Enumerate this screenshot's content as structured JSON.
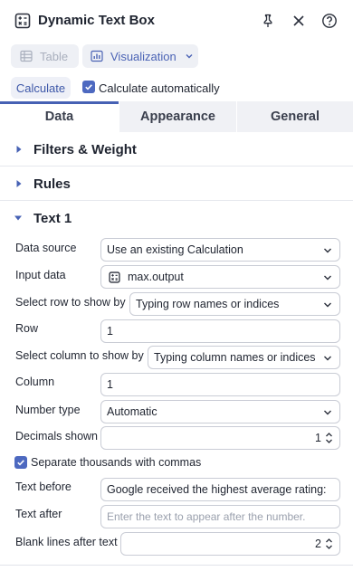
{
  "header": {
    "title": "Dynamic Text Box",
    "icons": [
      "calculator-icon",
      "pin-icon",
      "close-icon",
      "help-icon"
    ]
  },
  "toolbar": {
    "table_label": "Table",
    "visualization_label": "Visualization"
  },
  "calc": {
    "button_label": "Calculate",
    "auto_label": "Calculate automatically",
    "auto_checked": true
  },
  "tabs": [
    {
      "label": "Data",
      "active": true
    },
    {
      "label": "Appearance",
      "active": false
    },
    {
      "label": "General",
      "active": false
    }
  ],
  "sections": {
    "filters": "Filters & Weight",
    "rules": "Rules",
    "text1": "Text 1"
  },
  "form": {
    "data_source": {
      "label": "Data source",
      "value": "Use an existing Calculation"
    },
    "input_data": {
      "label": "Input data",
      "value": "max.output"
    },
    "select_row": {
      "label": "Select row to show by",
      "value": "Typing row names or indices"
    },
    "row": {
      "label": "Row",
      "value": "1"
    },
    "select_column": {
      "label": "Select column to show by",
      "value": "Typing column names or indices"
    },
    "column": {
      "label": "Column",
      "value": "1"
    },
    "number_type": {
      "label": "Number type",
      "value": "Automatic"
    },
    "decimals": {
      "label": "Decimals shown",
      "value": "1"
    },
    "separate_thousands": {
      "label": "Separate thousands with commas",
      "checked": true
    },
    "text_before": {
      "label": "Text before",
      "value": "Google received the highest average rating:"
    },
    "text_after": {
      "label": "Text after",
      "placeholder": "Enter the text to appear after the number."
    },
    "blank_lines": {
      "label": "Blank lines after text",
      "value": "2"
    }
  },
  "colors": {
    "accent": "#4661b4",
    "checkbox": "#4d69c0",
    "tab_bg": "#f0f1f5",
    "border": "#c9ccd5"
  }
}
